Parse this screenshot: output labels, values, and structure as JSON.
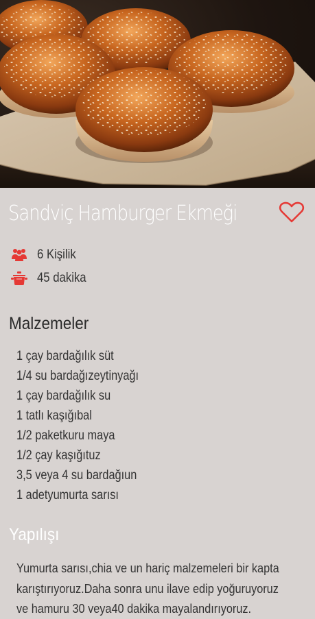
{
  "recipe": {
    "title": "Sandviç Hamburger Ekmeği",
    "favorite_icon": "heart-outline-icon",
    "accent_color": "#e53935",
    "servings": "6 Kişilik",
    "servings_icon": "people-icon",
    "duration": "45 dakika",
    "duration_icon": "cooking-pot-icon"
  },
  "ingredients": {
    "heading": "Malzemeler",
    "items": [
      "1 çay bardağılık süt",
      "1/4 su bardağızeytinyağı",
      "1 çay bardağılık su",
      "1 tatlı kaşığıbal",
      "1/2 paketkuru maya",
      "1/2 çay kaşığıtuz",
      "3,5 veya 4 su bardağıun",
      "1 adetyumurta sarısı"
    ]
  },
  "preparation": {
    "heading": "Yapılışı",
    "text": "Yumurta sarısı,chia ve un hariç malzemeleri bir kapta karıştırıyoruz.Daha sonra unu ilave edip yoğuruyoruz ve hamuru 30 veya40 dakika mayalandırıyoruz."
  }
}
